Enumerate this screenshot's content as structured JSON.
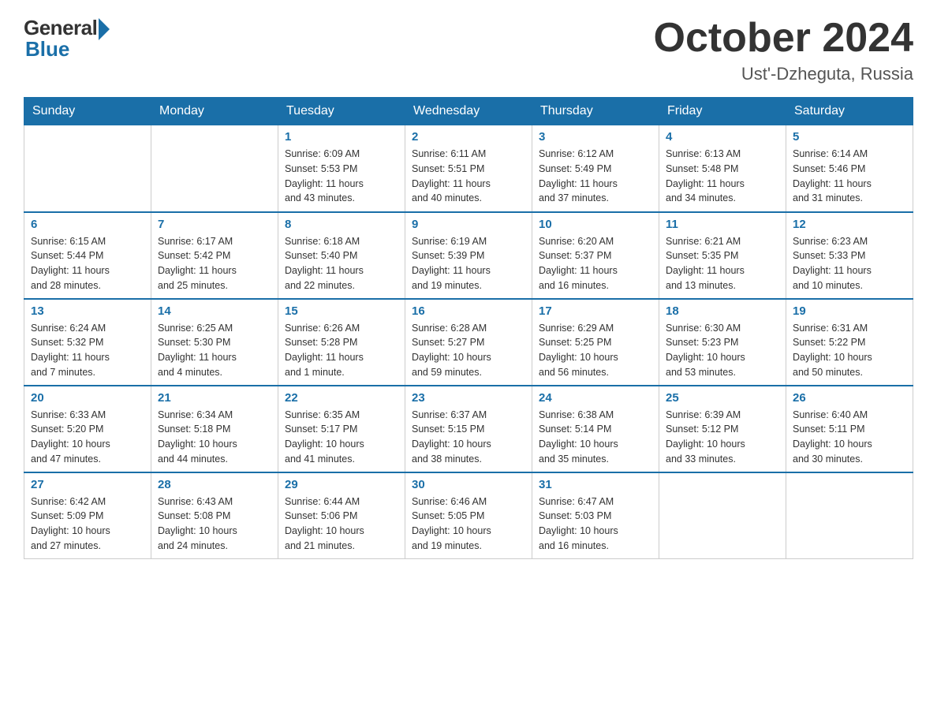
{
  "header": {
    "logo_general": "General",
    "logo_blue": "Blue",
    "month_title": "October 2024",
    "location": "Ust'-Dzheguta, Russia"
  },
  "days_of_week": [
    "Sunday",
    "Monday",
    "Tuesday",
    "Wednesday",
    "Thursday",
    "Friday",
    "Saturday"
  ],
  "weeks": [
    [
      {
        "day": "",
        "info": ""
      },
      {
        "day": "",
        "info": ""
      },
      {
        "day": "1",
        "info": "Sunrise: 6:09 AM\nSunset: 5:53 PM\nDaylight: 11 hours\nand 43 minutes."
      },
      {
        "day": "2",
        "info": "Sunrise: 6:11 AM\nSunset: 5:51 PM\nDaylight: 11 hours\nand 40 minutes."
      },
      {
        "day": "3",
        "info": "Sunrise: 6:12 AM\nSunset: 5:49 PM\nDaylight: 11 hours\nand 37 minutes."
      },
      {
        "day": "4",
        "info": "Sunrise: 6:13 AM\nSunset: 5:48 PM\nDaylight: 11 hours\nand 34 minutes."
      },
      {
        "day": "5",
        "info": "Sunrise: 6:14 AM\nSunset: 5:46 PM\nDaylight: 11 hours\nand 31 minutes."
      }
    ],
    [
      {
        "day": "6",
        "info": "Sunrise: 6:15 AM\nSunset: 5:44 PM\nDaylight: 11 hours\nand 28 minutes."
      },
      {
        "day": "7",
        "info": "Sunrise: 6:17 AM\nSunset: 5:42 PM\nDaylight: 11 hours\nand 25 minutes."
      },
      {
        "day": "8",
        "info": "Sunrise: 6:18 AM\nSunset: 5:40 PM\nDaylight: 11 hours\nand 22 minutes."
      },
      {
        "day": "9",
        "info": "Sunrise: 6:19 AM\nSunset: 5:39 PM\nDaylight: 11 hours\nand 19 minutes."
      },
      {
        "day": "10",
        "info": "Sunrise: 6:20 AM\nSunset: 5:37 PM\nDaylight: 11 hours\nand 16 minutes."
      },
      {
        "day": "11",
        "info": "Sunrise: 6:21 AM\nSunset: 5:35 PM\nDaylight: 11 hours\nand 13 minutes."
      },
      {
        "day": "12",
        "info": "Sunrise: 6:23 AM\nSunset: 5:33 PM\nDaylight: 11 hours\nand 10 minutes."
      }
    ],
    [
      {
        "day": "13",
        "info": "Sunrise: 6:24 AM\nSunset: 5:32 PM\nDaylight: 11 hours\nand 7 minutes."
      },
      {
        "day": "14",
        "info": "Sunrise: 6:25 AM\nSunset: 5:30 PM\nDaylight: 11 hours\nand 4 minutes."
      },
      {
        "day": "15",
        "info": "Sunrise: 6:26 AM\nSunset: 5:28 PM\nDaylight: 11 hours\nand 1 minute."
      },
      {
        "day": "16",
        "info": "Sunrise: 6:28 AM\nSunset: 5:27 PM\nDaylight: 10 hours\nand 59 minutes."
      },
      {
        "day": "17",
        "info": "Sunrise: 6:29 AM\nSunset: 5:25 PM\nDaylight: 10 hours\nand 56 minutes."
      },
      {
        "day": "18",
        "info": "Sunrise: 6:30 AM\nSunset: 5:23 PM\nDaylight: 10 hours\nand 53 minutes."
      },
      {
        "day": "19",
        "info": "Sunrise: 6:31 AM\nSunset: 5:22 PM\nDaylight: 10 hours\nand 50 minutes."
      }
    ],
    [
      {
        "day": "20",
        "info": "Sunrise: 6:33 AM\nSunset: 5:20 PM\nDaylight: 10 hours\nand 47 minutes."
      },
      {
        "day": "21",
        "info": "Sunrise: 6:34 AM\nSunset: 5:18 PM\nDaylight: 10 hours\nand 44 minutes."
      },
      {
        "day": "22",
        "info": "Sunrise: 6:35 AM\nSunset: 5:17 PM\nDaylight: 10 hours\nand 41 minutes."
      },
      {
        "day": "23",
        "info": "Sunrise: 6:37 AM\nSunset: 5:15 PM\nDaylight: 10 hours\nand 38 minutes."
      },
      {
        "day": "24",
        "info": "Sunrise: 6:38 AM\nSunset: 5:14 PM\nDaylight: 10 hours\nand 35 minutes."
      },
      {
        "day": "25",
        "info": "Sunrise: 6:39 AM\nSunset: 5:12 PM\nDaylight: 10 hours\nand 33 minutes."
      },
      {
        "day": "26",
        "info": "Sunrise: 6:40 AM\nSunset: 5:11 PM\nDaylight: 10 hours\nand 30 minutes."
      }
    ],
    [
      {
        "day": "27",
        "info": "Sunrise: 6:42 AM\nSunset: 5:09 PM\nDaylight: 10 hours\nand 27 minutes."
      },
      {
        "day": "28",
        "info": "Sunrise: 6:43 AM\nSunset: 5:08 PM\nDaylight: 10 hours\nand 24 minutes."
      },
      {
        "day": "29",
        "info": "Sunrise: 6:44 AM\nSunset: 5:06 PM\nDaylight: 10 hours\nand 21 minutes."
      },
      {
        "day": "30",
        "info": "Sunrise: 6:46 AM\nSunset: 5:05 PM\nDaylight: 10 hours\nand 19 minutes."
      },
      {
        "day": "31",
        "info": "Sunrise: 6:47 AM\nSunset: 5:03 PM\nDaylight: 10 hours\nand 16 minutes."
      },
      {
        "day": "",
        "info": ""
      },
      {
        "day": "",
        "info": ""
      }
    ]
  ]
}
